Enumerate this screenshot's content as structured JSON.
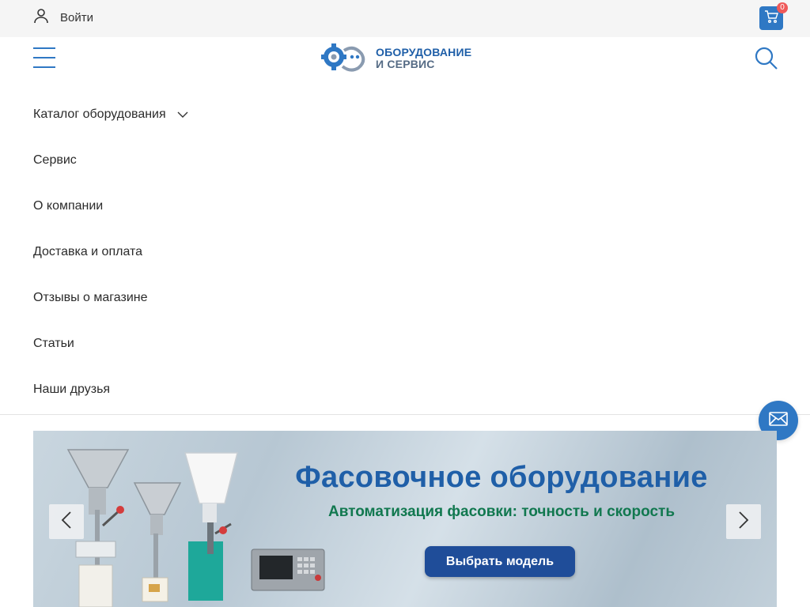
{
  "header": {
    "login_label": "Войти",
    "login_icon": "user-icon",
    "cart_count": "0",
    "cart_icon": "cart-icon",
    "search_icon": "search-icon",
    "menu_icon": "hamburger-icon",
    "accent_color": "#2f78c4"
  },
  "logo": {
    "line1": "ОБОРУДОВАНИЕ",
    "line2": "И СЕРВИС"
  },
  "nav": {
    "items": [
      {
        "label": "Каталог оборудования"
      },
      {
        "label": "Сервис"
      },
      {
        "label": "О компании"
      },
      {
        "label": "Доставка и оплата"
      },
      {
        "label": "Отзывы о магазине"
      },
      {
        "label": "Статьи"
      },
      {
        "label": "Наши друзья"
      }
    ]
  },
  "banner": {
    "title": "Фасовочное оборудование",
    "subtitle": "Автоматизация фасовки: точность и скорость",
    "cta_label": "Выбрать модель",
    "title_color": "#1f5fa8",
    "subtitle_color": "#11784f"
  },
  "floating": {
    "mail_icon": "mail-icon"
  }
}
